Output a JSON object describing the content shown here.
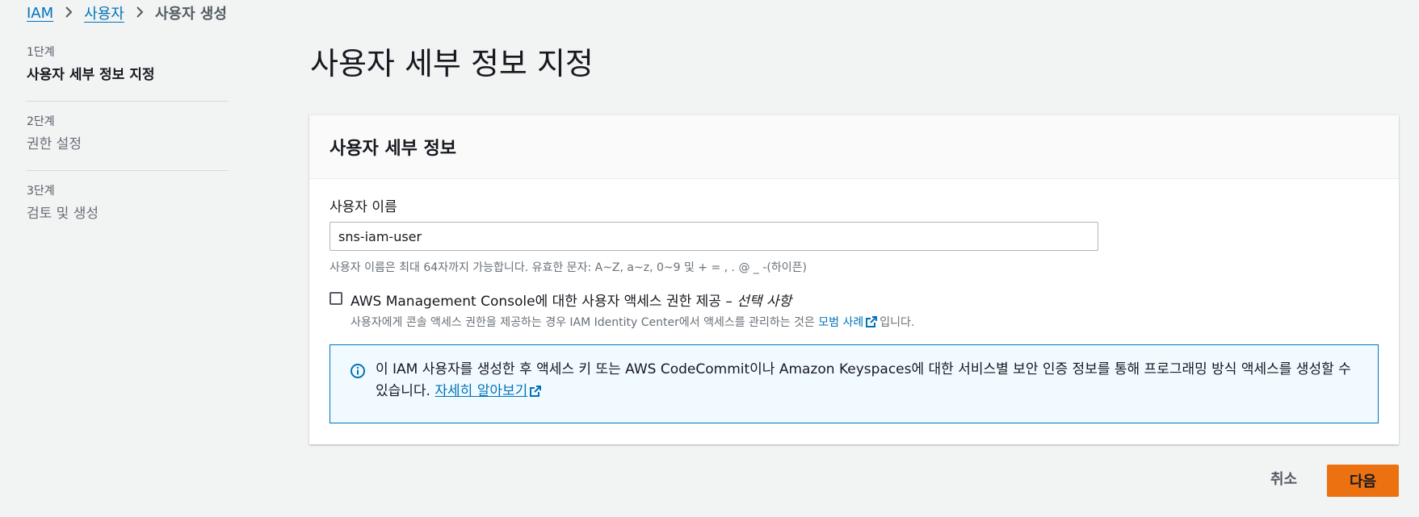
{
  "breadcrumb": {
    "items": [
      "IAM",
      "사용자"
    ],
    "current": "사용자 생성"
  },
  "steps": [
    {
      "num": "1단계",
      "title": "사용자 세부 정보 지정"
    },
    {
      "num": "2단계",
      "title": "권한 설정"
    },
    {
      "num": "3단계",
      "title": "검토 및 생성"
    }
  ],
  "page_title": "사용자 세부 정보 지정",
  "panel": {
    "header": "사용자 세부 정보",
    "username_label": "사용자 이름",
    "username_value": "sns-iam-user",
    "username_hint": "사용자 이름은 최대 64자까지 가능합니다. 유효한 문자: A~Z, a~z, 0~9 및 + = , . @ _ -(하이픈)",
    "console_access": {
      "label_main": "AWS Management Console에 대한 사용자 액세스 권한 제공 – ",
      "label_optional": "선택 사항",
      "desc_prefix": "사용자에게 콘솔 액세스 권한을 제공하는 경우 IAM Identity Center에서 액세스를 관리하는 것은 ",
      "desc_link": "모범 사례",
      "desc_suffix": "입니다.",
      "checked": false
    },
    "info": {
      "text": "이 IAM 사용자를 생성한 후 액세스 키 또는 AWS CodeCommit이나 Amazon Keyspaces에 대한 서비스별 보안 인증 정보를 통해 프로그래밍 방식 액세스를 생성할 수 있습니다. ",
      "link": "자세히 알아보기"
    }
  },
  "actions": {
    "cancel": "취소",
    "next": "다음"
  },
  "colors": {
    "primary_button": "#ec7211",
    "link": "#0073bb",
    "info_bg": "#f1faff"
  }
}
